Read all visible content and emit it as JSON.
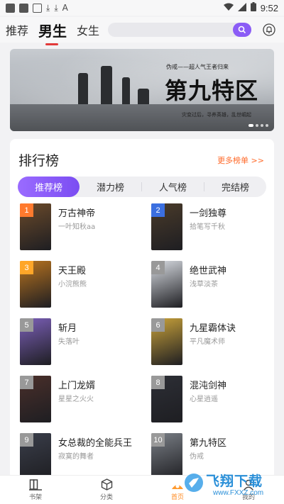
{
  "status_bar": {
    "time": "9:52"
  },
  "top_tabs": [
    {
      "label": "推荐"
    },
    {
      "label": "男生"
    },
    {
      "label": "女生"
    }
  ],
  "banner": {
    "subtitle": "伪戒——超人气王者归来",
    "title": "第九特区",
    "tagline": "灾变过后，寻养英雄，乱世崛起"
  },
  "ranking": {
    "title": "排行榜",
    "more": "更多榜单 >>",
    "segments": [
      "推荐榜",
      "潜力榜",
      "人气榜",
      "完结榜"
    ],
    "books": [
      {
        "rank": "1",
        "name": "万古神帝",
        "author": "一叶知秋aa",
        "rank_color": "#ff7a2e",
        "cover_color": "#6b4a2a"
      },
      {
        "rank": "2",
        "name": "一剑独尊",
        "author": "拾笔写千秋",
        "rank_color": "#3b6fe0",
        "cover_color": "#4a3b2a"
      },
      {
        "rank": "3",
        "name": "天王殿",
        "author": "小浣熊熊",
        "rank_color": "#ffa629",
        "cover_color": "#b8731f"
      },
      {
        "rank": "4",
        "name": "绝世武神",
        "author": "浅草淡茶",
        "rank_color": "#999999",
        "cover_color": "#d9dde3"
      },
      {
        "rank": "5",
        "name": "斩月",
        "author": "失落叶",
        "rank_color": "#999999",
        "cover_color": "#7b5fb8"
      },
      {
        "rank": "6",
        "name": "九星霸体诀",
        "author": "平凡魔术师",
        "rank_color": "#999999",
        "cover_color": "#c9a23a"
      },
      {
        "rank": "7",
        "name": "上门龙婿",
        "author": "星星之火火",
        "rank_color": "#999999",
        "cover_color": "#4a2f2a"
      },
      {
        "rank": "8",
        "name": "混沌剑神",
        "author": "心星逍遥",
        "rank_color": "#999999",
        "cover_color": "#2d2f36"
      },
      {
        "rank": "9",
        "name": "女总裁的全能兵王",
        "author": "寂寞的舞者",
        "rank_color": "#999999",
        "cover_color": "#3a3e4a"
      },
      {
        "rank": "10",
        "name": "第九特区",
        "author": "伪戒",
        "rank_color": "#999999",
        "cover_color": "#7a7f86"
      }
    ]
  },
  "bottom_nav": [
    {
      "label": "书架",
      "icon": "bookshelf-icon"
    },
    {
      "label": "分类",
      "icon": "category-cube-icon"
    },
    {
      "label": "首页",
      "icon": "home-icon"
    },
    {
      "label": "我的",
      "icon": "profile-icon"
    }
  ],
  "watermark": {
    "text": "飞翔下载",
    "url": "www.FXXZ.com"
  },
  "colors": {
    "accent": "#8b5cf6",
    "more_link": "#ff6a2a",
    "tab_indicator": "#e23a3a",
    "nav_active": "#ff8a1f"
  }
}
